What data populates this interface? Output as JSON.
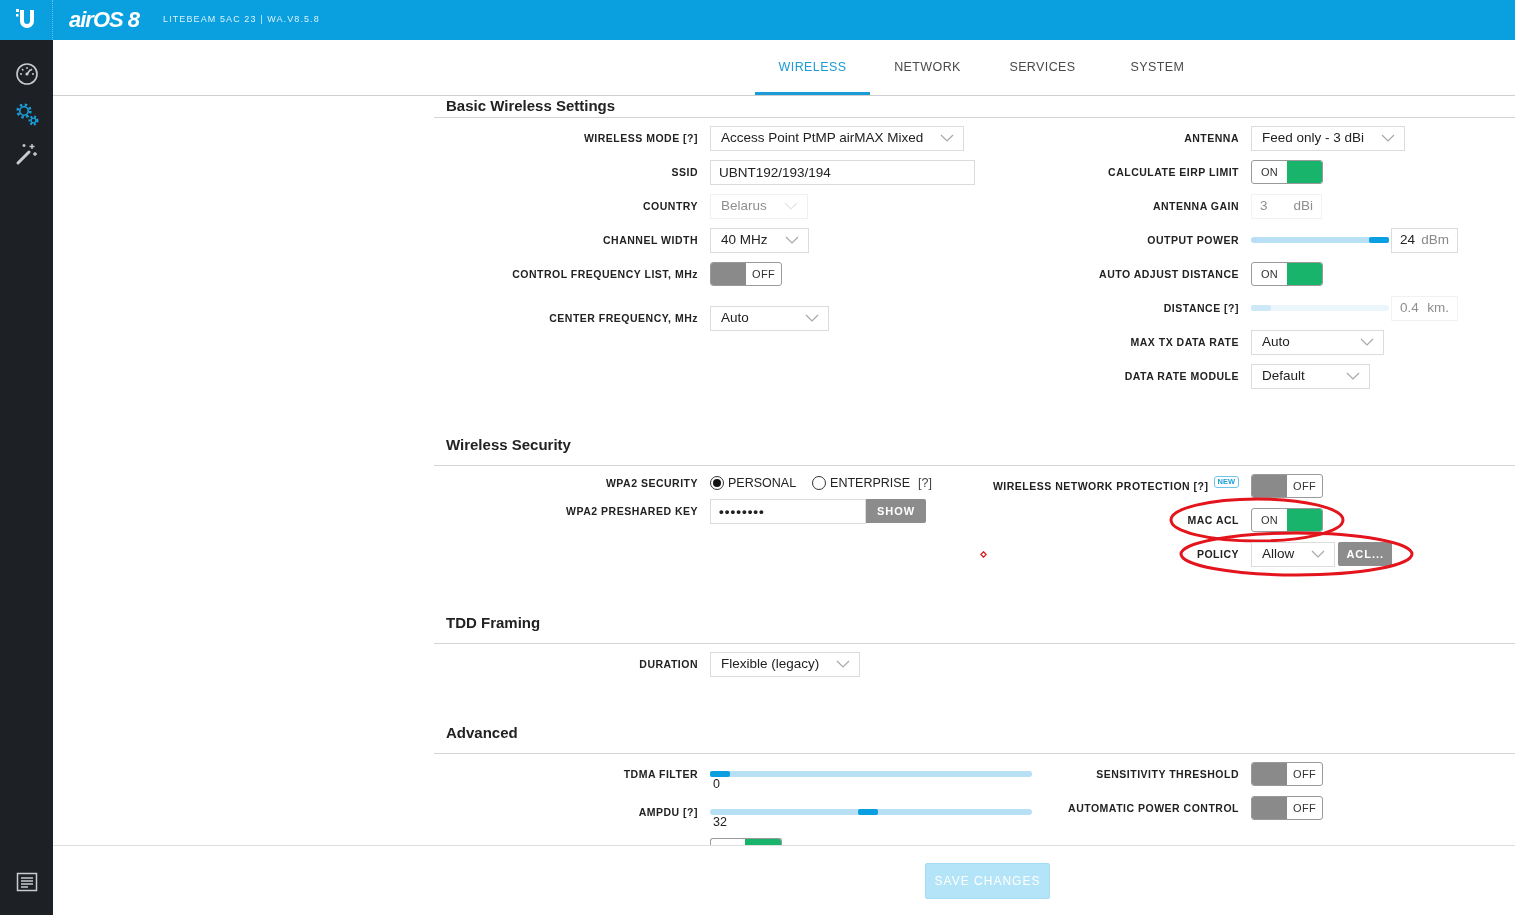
{
  "header": {
    "logo_text": "airOS 8",
    "device_info": "LITEBEAM 5AC 23 | WA.V8.5.8"
  },
  "sidebar": {
    "items": [
      {
        "kind": "dashboard",
        "selected": false
      },
      {
        "kind": "settings",
        "selected": true
      },
      {
        "kind": "tools",
        "selected": false
      }
    ],
    "bottom_items": [
      {
        "kind": "log"
      }
    ]
  },
  "tabs": [
    {
      "label": "WIRELESS",
      "selected": true
    },
    {
      "label": "NETWORK",
      "selected": false
    },
    {
      "label": "SERVICES",
      "selected": false
    },
    {
      "label": "SYSTEM",
      "selected": false
    }
  ],
  "sections": [
    {
      "title": "Basic Wireless Settings",
      "left": [
        {
          "kind": "select",
          "label": "WIRELESS MODE [?]",
          "value": "Access Point PtMP airMAX Mixed",
          "disabled": false
        },
        {
          "kind": "input",
          "label": "SSID",
          "value": "UBNT192/193/194"
        },
        {
          "kind": "select",
          "label": "COUNTRY",
          "value": "Belarus",
          "disabled": true
        },
        {
          "kind": "select",
          "label": "CHANNEL WIDTH",
          "value": "40 MHz",
          "disabled": false
        },
        {
          "kind": "toggle",
          "label": "CONTROL FREQUENCY LIST, MHz",
          "on": false,
          "state_text": "OFF"
        },
        {
          "kind": "select",
          "label": "CENTER FREQUENCY, MHz",
          "value": "Auto",
          "disabled": false
        }
      ],
      "right": [
        {
          "kind": "select",
          "label": "ANTENNA",
          "value": "Feed only - 3 dBi",
          "disabled": false
        },
        {
          "kind": "toggle",
          "label": "CALCULATE EIRP LIMIT",
          "on": true,
          "state_text": "ON"
        },
        {
          "kind": "unit_input",
          "label": "ANTENNA GAIN",
          "value": "3",
          "unit": "dBi",
          "disabled": true
        },
        {
          "kind": "slider_input",
          "label": "OUTPUT POWER",
          "level": 1,
          "value": "24",
          "unit": "dBm",
          "disabled": false
        },
        {
          "kind": "toggle",
          "label": "AUTO ADJUST DISTANCE",
          "on": true,
          "state_text": "ON"
        },
        {
          "kind": "slider_input",
          "label": "DISTANCE [?]",
          "level": 0,
          "value": "0.4",
          "unit": "km.",
          "disabled": true
        },
        {
          "kind": "select",
          "label": "MAX TX DATA RATE",
          "value": "Auto",
          "disabled": false
        },
        {
          "kind": "select",
          "label": "DATA RATE MODULE",
          "value": "Default",
          "disabled": false
        }
      ]
    },
    {
      "title": "Wireless Security",
      "left": [
        {
          "kind": "radios",
          "label": "WPA2 SECURITY",
          "options": [
            {
              "label": "PERSONAL",
              "selected": true
            },
            {
              "label": "ENTERPRISE",
              "selected": false
            }
          ],
          "help": "[?]"
        },
        {
          "kind": "password",
          "label": "WPA2 PRESHARED KEY",
          "value": "••••••••",
          "button": "SHOW"
        }
      ],
      "right": [
        {
          "kind": "toggle",
          "label": "WIRELESS NETWORK PROTECTION [?]",
          "badge": "NEW",
          "on": false,
          "state_text": "OFF"
        },
        {
          "kind": "toggle",
          "label": "MAC ACL",
          "on": true,
          "state_text": "ON",
          "circled": true
        },
        {
          "kind": "select",
          "label": "POLICY",
          "value": "Allow",
          "disabled": false,
          "button": "ACL...",
          "circled": true,
          "marker": true
        }
      ]
    },
    {
      "title": "TDD Framing",
      "left": [
        {
          "kind": "select",
          "label": "DURATION",
          "value": "Flexible (legacy)",
          "disabled": false
        }
      ]
    },
    {
      "title": "Advanced",
      "left": [
        {
          "kind": "slider",
          "label": "TDMA FILTER",
          "level": 0,
          "reading": "0"
        },
        {
          "kind": "slider",
          "label": "AMPDU [?]",
          "level": 0.49,
          "reading": "32"
        },
        {
          "kind": "toggle_edge",
          "on": true
        }
      ],
      "right": [
        {
          "kind": "toggle",
          "label": "SENSITIVITY THRESHOLD",
          "on": false,
          "state_text": "OFF"
        },
        {
          "kind": "toggle",
          "label": "AUTOMATIC POWER CONTROL",
          "on": false,
          "state_text": "OFF"
        }
      ]
    }
  ],
  "footer": {
    "save_button": {
      "label": "SAVE CHANGES",
      "disabled": true
    }
  }
}
